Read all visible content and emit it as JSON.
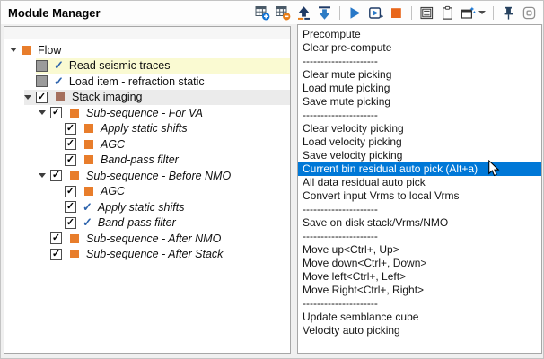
{
  "window": {
    "title": "Module Manager"
  },
  "toolbar": {
    "icons": [
      {
        "name": "add-module-icon"
      },
      {
        "name": "remove-module-icon"
      },
      {
        "name": "move-up-icon"
      },
      {
        "name": "move-down-icon"
      },
      {
        "name": "separator"
      },
      {
        "name": "run-icon"
      },
      {
        "name": "run-flow-icon"
      },
      {
        "name": "stop-icon"
      },
      {
        "name": "separator"
      },
      {
        "name": "module-list-icon"
      },
      {
        "name": "clipboard-icon"
      },
      {
        "name": "new-window-icon"
      },
      {
        "name": "chevron-down-icon"
      },
      {
        "name": "separator"
      },
      {
        "name": "pin-icon"
      },
      {
        "name": "float-window-icon"
      }
    ]
  },
  "tree": {
    "items": [
      {
        "label": "Flow",
        "depth": 0,
        "expander": true,
        "checkbox": "none",
        "icon": "orange-square",
        "italic": false,
        "row_bg": "none"
      },
      {
        "label": "Read seismic traces",
        "depth": 1,
        "expander": false,
        "checkbox": "gray",
        "icon": "blue-check",
        "italic": false,
        "row_bg": "yellow"
      },
      {
        "label": "Load item - refraction static",
        "depth": 1,
        "expander": false,
        "checkbox": "gray",
        "icon": "blue-check",
        "italic": false,
        "row_bg": "none"
      },
      {
        "label": "Stack imaging",
        "depth": 1,
        "expander": true,
        "checkbox": "checked",
        "icon": "brown-square",
        "italic": false,
        "row_bg": "gray"
      },
      {
        "label": "Sub-sequence - For VA",
        "depth": 2,
        "expander": true,
        "checkbox": "checked",
        "icon": "orange-square",
        "italic": true,
        "row_bg": "none"
      },
      {
        "label": "Apply static shifts",
        "depth": 3,
        "expander": false,
        "checkbox": "checked",
        "icon": "orange-square",
        "italic": true,
        "row_bg": "none"
      },
      {
        "label": "AGC",
        "depth": 3,
        "expander": false,
        "checkbox": "checked",
        "icon": "orange-square",
        "italic": true,
        "row_bg": "none"
      },
      {
        "label": "Band-pass filter",
        "depth": 3,
        "expander": false,
        "checkbox": "checked",
        "icon": "orange-square",
        "italic": true,
        "row_bg": "none"
      },
      {
        "label": "Sub-sequence - Before NMO",
        "depth": 2,
        "expander": true,
        "checkbox": "checked",
        "icon": "orange-square",
        "italic": true,
        "row_bg": "none"
      },
      {
        "label": "AGC",
        "depth": 3,
        "expander": false,
        "checkbox": "checked",
        "icon": "orange-square",
        "italic": true,
        "row_bg": "none"
      },
      {
        "label": "Apply static shifts",
        "depth": 3,
        "expander": false,
        "checkbox": "checked",
        "icon": "blue-check",
        "italic": true,
        "row_bg": "none"
      },
      {
        "label": "Band-pass filter",
        "depth": 3,
        "expander": false,
        "checkbox": "checked",
        "icon": "blue-check",
        "italic": true,
        "row_bg": "none"
      },
      {
        "label": "Sub-sequence - After NMO",
        "depth": 2,
        "expander": false,
        "checkbox": "checked",
        "icon": "orange-square",
        "italic": true,
        "row_bg": "none"
      },
      {
        "label": "Sub-sequence - After Stack",
        "depth": 2,
        "expander": false,
        "checkbox": "checked",
        "icon": "orange-square",
        "italic": true,
        "row_bg": "none"
      }
    ]
  },
  "menu": {
    "items": [
      {
        "label": "Precompute"
      },
      {
        "label": "Clear pre-compute"
      },
      {
        "label": "---------------------",
        "separator": true
      },
      {
        "label": "Clear mute picking"
      },
      {
        "label": "Load mute picking"
      },
      {
        "label": "Save mute picking"
      },
      {
        "label": "---------------------",
        "separator": true
      },
      {
        "label": "Clear velocity picking"
      },
      {
        "label": "Load velocity picking"
      },
      {
        "label": "Save velocity picking"
      },
      {
        "label": "Current bin residual auto pick (Alt+a)",
        "selected": true
      },
      {
        "label": "All data residual auto pick"
      },
      {
        "label": "Convert input Vrms to local Vrms"
      },
      {
        "label": "---------------------",
        "separator": true
      },
      {
        "label": "Save on disk stack/Vrms/NMO"
      },
      {
        "label": "---------------------",
        "separator": true
      },
      {
        "label": "Move up<Ctrl+, Up>"
      },
      {
        "label": "Move down<Ctrl+, Down>"
      },
      {
        "label": "Move left<Ctrl+, Left>"
      },
      {
        "label": "Move Right<Ctrl+, Right>"
      },
      {
        "label": "---------------------",
        "separator": true
      },
      {
        "label": "Update semblance cube"
      },
      {
        "label": "Velocity auto picking"
      }
    ]
  },
  "colors": {
    "selection_blue": "#0078d7",
    "row_highlight_yellow": "#fafad2",
    "row_highlight_gray": "#ebebeb",
    "module_orange": "#e87d2b",
    "module_brown": "#a5705e",
    "check_blue": "#2e64ad",
    "stop_orange": "#e8671c"
  }
}
